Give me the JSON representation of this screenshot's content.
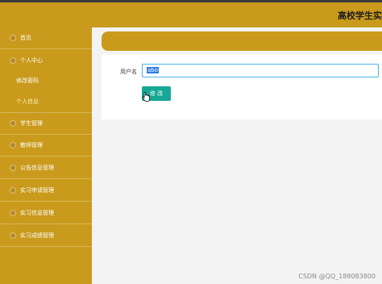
{
  "header": {
    "title": "高校学生实"
  },
  "sidebar": {
    "items": [
      {
        "label": "首页"
      },
      {
        "label": "个人中心"
      },
      {
        "label": "学生管理"
      },
      {
        "label": "教师管理"
      },
      {
        "label": "公告信息管理"
      },
      {
        "label": "实习申请管理"
      },
      {
        "label": "实习信息管理"
      },
      {
        "label": "实习成绩管理"
      }
    ],
    "sub_items": [
      {
        "label": "修改密码"
      },
      {
        "label": "个人信息",
        "active": true
      }
    ]
  },
  "form": {
    "username_label": "用户名",
    "username_value": "abo",
    "submit_label": "修 改"
  },
  "watermark": "CSDN @QQ_188083800",
  "colors": {
    "sidebar": "#c99a1b",
    "button": "#16a795",
    "input_border": "#4ab3e6",
    "selection": "#2e7de1"
  }
}
